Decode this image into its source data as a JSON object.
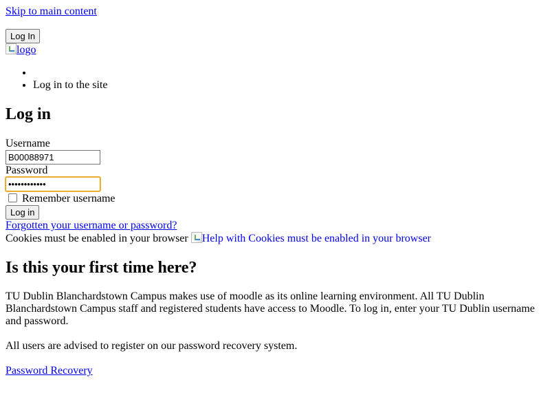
{
  "skip_link": {
    "label": "Skip to main content"
  },
  "header": {
    "login_button": "Log In",
    "logo_alt": "logo"
  },
  "breadcrumb": {
    "items": [
      "",
      "Log in to the site"
    ]
  },
  "login_form": {
    "heading": "Log in",
    "username_label": "Username",
    "username_value": "B00088971",
    "password_label": "Password",
    "password_value": "••••••••••••",
    "remember_label": "Remember username",
    "remember_checked": false,
    "submit_label": "Log in",
    "forgot_link": "Forgotten your username or password?",
    "cookies_text": "Cookies must be enabled in your browser",
    "cookies_help": "Help with Cookies must be enabled in your browser"
  },
  "first_time": {
    "heading": "Is this your first time here?",
    "paragraph1": "TU Dublin Blanchardstown Campus makes use of moodle as its online learning environment. All TU Dublin Blanchardstown Campus staff and registered students have access to Moodle. To log in, enter your TU Dublin username and password.",
    "paragraph2": "All users are advised to register on our password recovery system.",
    "recovery_link": "Password Recovery"
  },
  "colors": {
    "link": "#0000ee",
    "focus_ring": "#e8a317",
    "button_bg": "#efefef"
  }
}
